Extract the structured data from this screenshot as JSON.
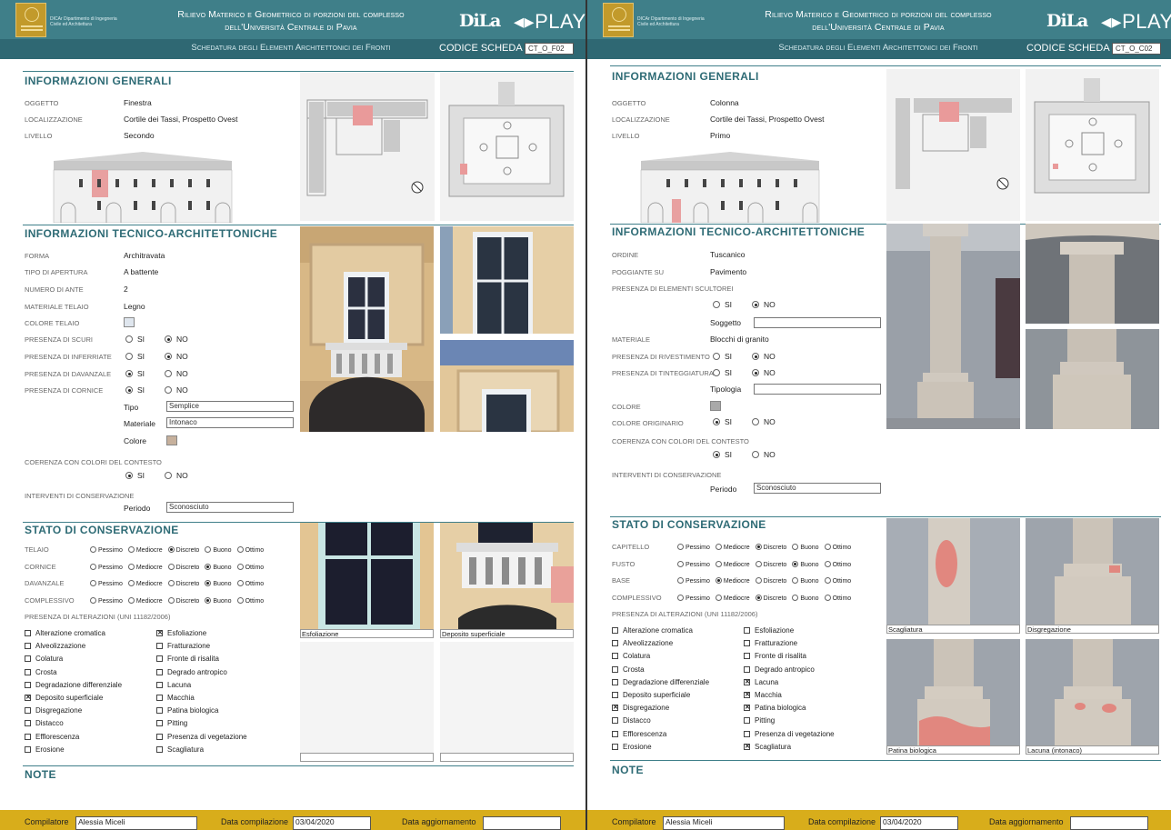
{
  "sheets": [
    {
      "header": {
        "department": "DICAr Dipartimento di Ingegneria Civile ed Architettura",
        "title_line1": "Rilievo Materico e Geometrico di porzioni del complesso",
        "title_line2": "dell'Università Centrale di Pavia",
        "logo_dila": "DiLa",
        "logo_play": "PLAY",
        "subtitle": "Schedatura degli Elementi Architettonici dei Fronti",
        "codice_label": "CODICE SCHEDA",
        "codice_value": "CT_O_F02"
      },
      "generali": {
        "title": "INFORMAZIONI GENERALI",
        "oggetto_label": "OGGETTO",
        "oggetto": "Finestra",
        "localizzazione_label": "LOCALIZZAZIONE",
        "localizzazione": "Cortile dei Tassi, Prospetto Ovest",
        "livello_label": "LIVELLO",
        "livello": "Secondo"
      },
      "tecnico": {
        "title": "INFORMAZIONI TECNICO-ARCHITETTONICHE",
        "rows": [
          {
            "label": "FORMA",
            "value": "Architravata"
          },
          {
            "label": "TIPO DI APERTURA",
            "value": "A battente"
          },
          {
            "label": "NUMERO DI ANTE",
            "value": "2"
          },
          {
            "label": "MATERIALE TELAIO",
            "value": "Legno"
          },
          {
            "label": "COLORE TELAIO",
            "value": ""
          }
        ],
        "radios": [
          {
            "label": "PRESENZA DI SCURI",
            "si": "SI",
            "no": "NO",
            "selected": "no"
          },
          {
            "label": "PRESENZA DI INFERRIATE",
            "si": "SI",
            "no": "NO",
            "selected": "no"
          },
          {
            "label": "PRESENZA DI DAVANZALE",
            "si": "SI",
            "no": "NO",
            "selected": "si"
          },
          {
            "label": "PRESENZA DI CORNICE",
            "si": "SI",
            "no": "NO",
            "selected": "si"
          }
        ],
        "tipo_label": "Tipo",
        "tipo": "Semplice",
        "materiale_label": "Materiale",
        "materiale": "Intonaco",
        "colore_label": "Colore",
        "coerenza_label": "COERENZA CON COLORI DEL CONTESTO",
        "coerenza_si": "SI",
        "coerenza_no": "NO",
        "interventi_label": "INTERVENTI DI CONSERVAZIONE",
        "periodo_label": "Periodo",
        "periodo": "Sconosciuto"
      },
      "stato": {
        "title": "STATO DI CONSERVAZIONE",
        "options": [
          "Pessimo",
          "Mediocre",
          "Discreto",
          "Buono",
          "Ottimo"
        ],
        "rows": [
          {
            "label": "TELAIO",
            "selected": 2
          },
          {
            "label": "CORNICE",
            "selected": 3
          },
          {
            "label": "DAVANZALE",
            "selected": 3
          },
          {
            "label": "COMPLESSIVO",
            "selected": 3
          }
        ],
        "alterazioni_label": "PRESENZA DI ALTERAZIONI (UNI 11182/2006)",
        "col1": [
          {
            "label": "Alterazione cromatica",
            "checked": false
          },
          {
            "label": "Alveolizzazione",
            "checked": false
          },
          {
            "label": "Colatura",
            "checked": false
          },
          {
            "label": "Crosta",
            "checked": false
          },
          {
            "label": "Degradazione differenziale",
            "checked": false
          },
          {
            "label": "Deposito superficiale",
            "checked": true
          },
          {
            "label": "Disgregazione",
            "checked": false
          },
          {
            "label": "Distacco",
            "checked": false
          },
          {
            "label": "Efflorescenza",
            "checked": false
          },
          {
            "label": "Erosione",
            "checked": false
          }
        ],
        "col2": [
          {
            "label": "Esfoliazione",
            "checked": true
          },
          {
            "label": "Fratturazione",
            "checked": false
          },
          {
            "label": "Fronte di risalita",
            "checked": false
          },
          {
            "label": "Degrado antropico",
            "checked": false
          },
          {
            "label": "Lacuna",
            "checked": false
          },
          {
            "label": "Macchia",
            "checked": false
          },
          {
            "label": "Patina biologica",
            "checked": false
          },
          {
            "label": "Pitting",
            "checked": false
          },
          {
            "label": "Presenza di vegetazione",
            "checked": false
          },
          {
            "label": "Scagliatura",
            "checked": false
          }
        ],
        "captions": [
          "Esfoliazione",
          "Deposito superficiale"
        ]
      },
      "note": {
        "title": "NOTE"
      },
      "footer": {
        "compilatore_label": "Compilatore",
        "compilatore": "Alessia Miceli",
        "data_label": "Data compilazione",
        "data": "03/04/2020",
        "aggiornamento_label": "Data aggiornamento",
        "aggiornamento": ""
      },
      "colors": {
        "telaio": "#dfe6ee",
        "cornice": "#c6b09c",
        "header": "#3f7f89",
        "footer": "#d8ad1b"
      }
    },
    {
      "header": {
        "department": "DICAr Dipartimento di Ingegneria Civile ed Architettura",
        "title_line1": "Rilievo Materico e Geometrico di porzioni del complesso",
        "title_line2": "dell'Università Centrale di Pavia",
        "logo_dila": "DiLa",
        "logo_play": "PLAY",
        "subtitle": "Schedatura degli Elementi Architettonici dei Fronti",
        "codice_label": "CODICE SCHEDA",
        "codice_value": "CT_O_C02"
      },
      "generali": {
        "title": "INFORMAZIONI GENERALI",
        "oggetto_label": "OGGETTO",
        "oggetto": "Colonna",
        "localizzazione_label": "LOCALIZZAZIONE",
        "localizzazione": "Cortile dei Tassi, Prospetto Ovest",
        "livello_label": "LIVELLO",
        "livello": "Primo"
      },
      "tecnico": {
        "title": "INFORMAZIONI TECNICO-ARCHITETTONICHE",
        "ordine_label": "ORDINE",
        "ordine": "Tuscanico",
        "poggiante_label": "POGGIANTE SU",
        "poggiante": "Pavimento",
        "scultorei_label": "PRESENZA DI ELEMENTI SCULTOREI",
        "scultorei_si": "SI",
        "scultorei_no": "NO",
        "soggetto_label": "Soggetto",
        "soggetto": "",
        "materiale_label": "MATERIALE",
        "materiale": "Blocchi di granito",
        "rivestimento_label": "PRESENZA DI RIVESTIMENTO",
        "tinteggiatura_label": "PRESENZA DI TINTEGGIATURA",
        "si": "SI",
        "no": "NO",
        "tipologia_label": "Tipologia",
        "tipologia": "",
        "colore_label": "COLORE",
        "originario_label": "COLORE ORIGINARIO",
        "coerenza_label": "COERENZA CON COLORI DEL CONTESTO",
        "interventi_label": "INTERVENTI DI CONSERVAZIONE",
        "periodo_label": "Periodo",
        "periodo": "Sconosciuto"
      },
      "stato": {
        "title": "STATO DI CONSERVAZIONE",
        "options": [
          "Pessimo",
          "Mediocre",
          "Discreto",
          "Buono",
          "Ottimo"
        ],
        "rows": [
          {
            "label": "CAPITELLO",
            "selected": 2
          },
          {
            "label": "FUSTO",
            "selected": 3
          },
          {
            "label": "BASE",
            "selected": 1
          },
          {
            "label": "COMPLESSIVO",
            "selected": 2
          }
        ],
        "alterazioni_label": "PRESENZA DI ALTERAZIONI (UNI 11182/2006)",
        "col1": [
          {
            "label": "Alterazione cromatica",
            "checked": false
          },
          {
            "label": "Alveolizzazione",
            "checked": false
          },
          {
            "label": "Colatura",
            "checked": false
          },
          {
            "label": "Crosta",
            "checked": false
          },
          {
            "label": "Degradazione differenziale",
            "checked": false
          },
          {
            "label": "Deposito superficiale",
            "checked": false
          },
          {
            "label": "Disgregazione",
            "checked": true
          },
          {
            "label": "Distacco",
            "checked": false
          },
          {
            "label": "Efflorescenza",
            "checked": false
          },
          {
            "label": "Erosione",
            "checked": false
          }
        ],
        "col2": [
          {
            "label": "Esfoliazione",
            "checked": false
          },
          {
            "label": "Fratturazione",
            "checked": false
          },
          {
            "label": "Fronte di risalita",
            "checked": false
          },
          {
            "label": "Degrado antropico",
            "checked": false
          },
          {
            "label": "Lacuna",
            "checked": true
          },
          {
            "label": "Macchia",
            "checked": true
          },
          {
            "label": "Patina biologica",
            "checked": true
          },
          {
            "label": "Pitting",
            "checked": false
          },
          {
            "label": "Presenza di vegetazione",
            "checked": false
          },
          {
            "label": "Scagliatura",
            "checked": true
          }
        ],
        "captions": [
          "Scagliatura",
          "Disgregazione",
          "Patina biologica",
          "Lacuna (intonaco)"
        ]
      },
      "note": {
        "title": "NOTE"
      },
      "footer": {
        "compilatore_label": "Compilatore",
        "compilatore": "Alessia Miceli",
        "data_label": "Data compilazione",
        "data": "03/04/2020",
        "aggiornamento_label": "Data aggiornamento",
        "aggiornamento": ""
      },
      "colors": {
        "colore": "#a9a9a9"
      }
    }
  ]
}
